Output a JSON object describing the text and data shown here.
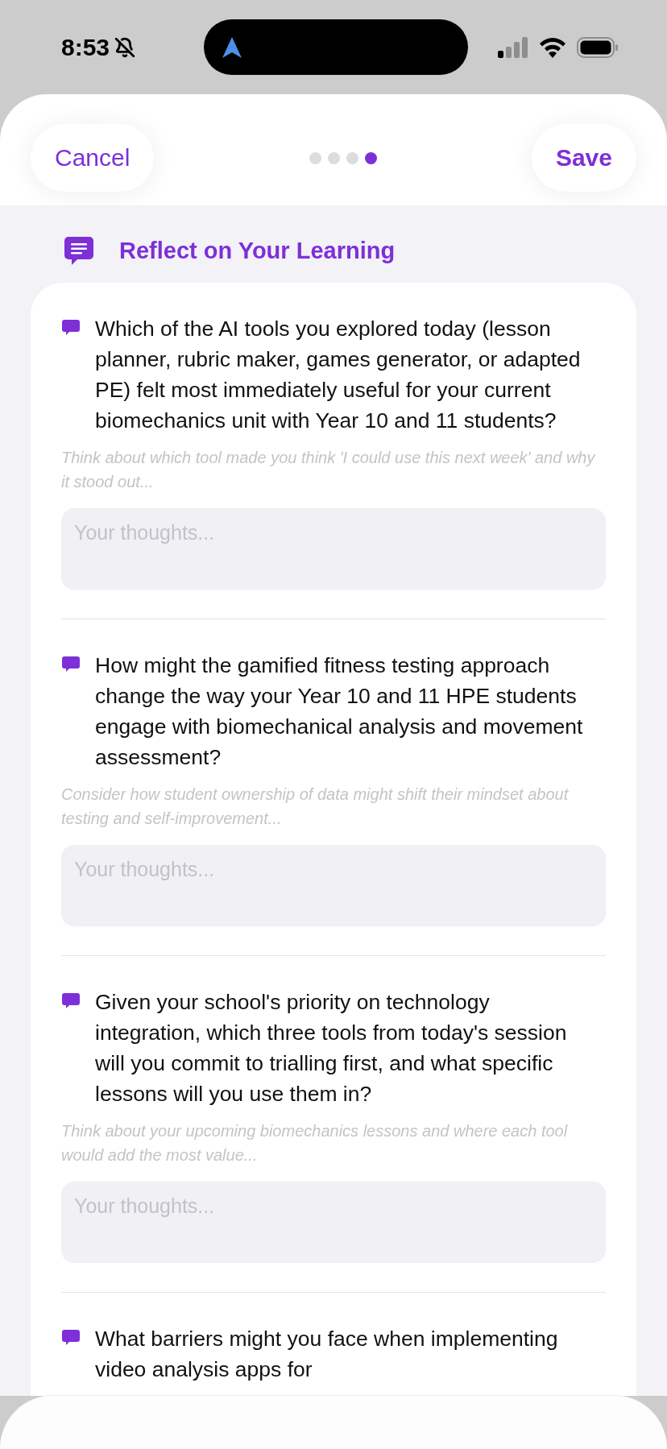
{
  "status_bar": {
    "time": "8:53"
  },
  "header": {
    "cancel": "Cancel",
    "save": "Save",
    "steps": [
      {
        "selected": false
      },
      {
        "selected": false
      },
      {
        "selected": false
      },
      {
        "selected": true
      }
    ]
  },
  "section": {
    "title": "Reflect on Your Learning"
  },
  "questions": [
    {
      "question": "Which of the AI tools you explored today (lesson planner, rubric maker, games generator, or adapted PE) felt most immediately useful for your current biomechanics unit with Year 10 and 11 students?",
      "hint": "Think about which tool made you think 'I could use this next week' and why it stood out...",
      "answer": {
        "placeholder": "Your thoughts..."
      }
    },
    {
      "question": "How might the gamified fitness testing approach change the way your Year 10 and 11 HPE students engage with biomechanical analysis and movement assessment?",
      "hint": "Consider how student ownership of data might shift their mindset about testing and self-improvement...",
      "answer": {
        "placeholder": "Your thoughts..."
      }
    },
    {
      "question": "Given your school's priority on technology integration, which three tools from today's session will you commit to trialling first, and what specific lessons will you use them in?",
      "hint": "Think about your upcoming biomechanics lessons and where each tool would add the most value...",
      "answer": {
        "placeholder": "Your thoughts..."
      }
    },
    {
      "question": "What barriers might you face when implementing video analysis apps for"
    }
  ]
}
